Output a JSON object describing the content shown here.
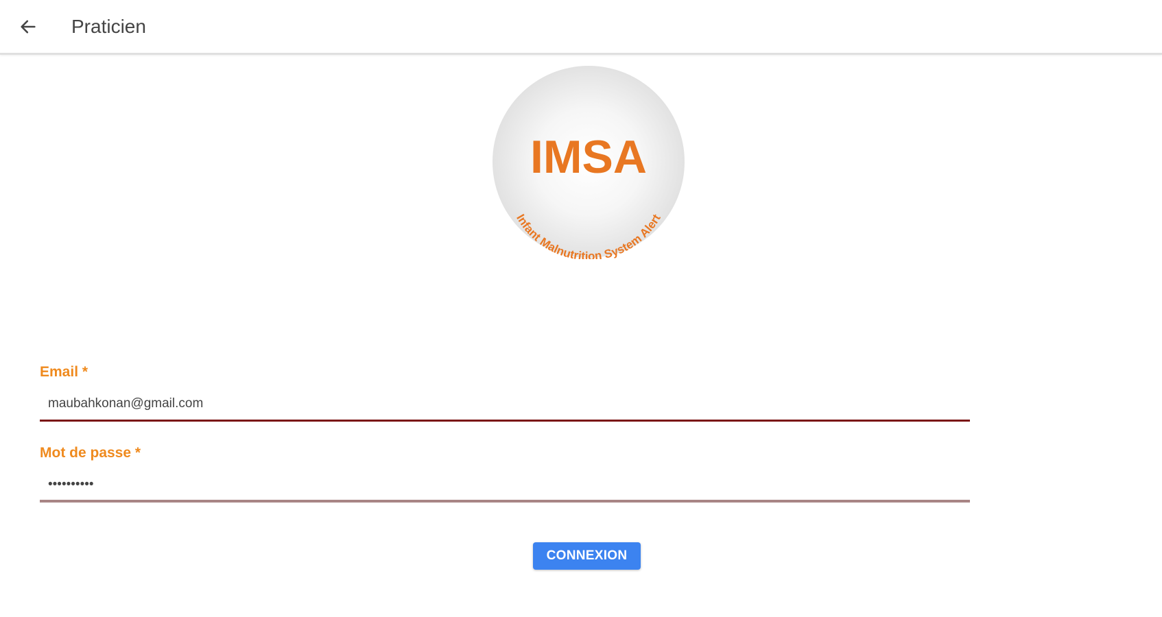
{
  "header": {
    "back_icon": "arrow-left-icon",
    "title": "Praticien"
  },
  "logo": {
    "title": "IMSA",
    "subtitle": "Infant Malnutrition System Alert",
    "accent_color": "#e87722"
  },
  "form": {
    "email": {
      "label": "Email *",
      "value": "maubahkonan@gmail.com"
    },
    "password": {
      "label": "Mot de passe *",
      "value": "••••••••••"
    },
    "submit_label": "CONNEXION"
  },
  "colors": {
    "label_accent": "#ef8a1e",
    "button": "#3c83f0",
    "email_underline": "#7a1212",
    "password_underline": "#a88585"
  }
}
